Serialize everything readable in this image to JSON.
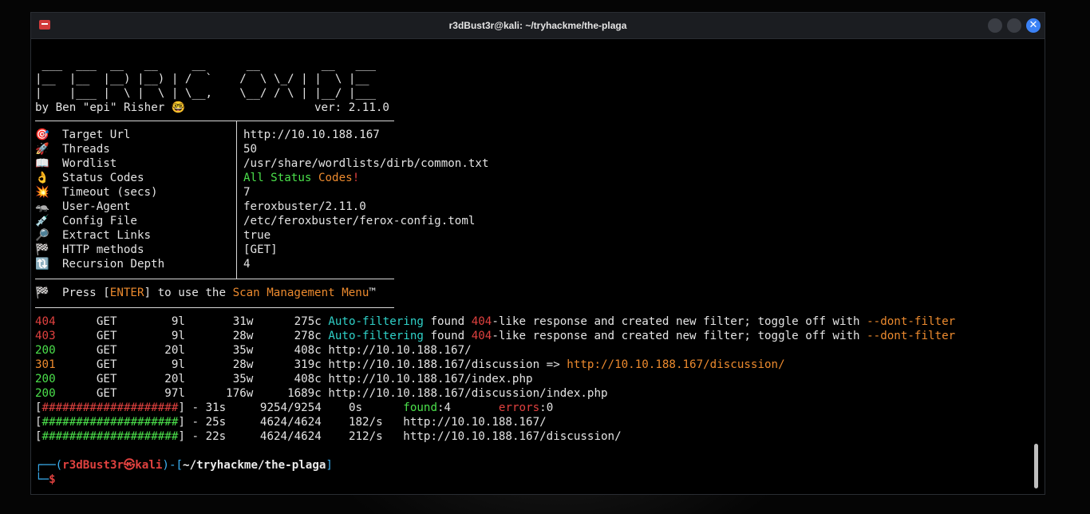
{
  "window": {
    "title": "r3dBust3r@kali: ~/tryhackme/the-plaga",
    "close_glyph": "✕"
  },
  "banner": {
    "line1": " ___  ___  __   __     __      __         __   ___",
    "line2": "|__  |__  |__) |__) | /  `    /  \\ \\_/ | |  \\ |__",
    "line3": "|    |___ |  \\ |  \\ | \\__,    \\__/ / \\ | |__/ |___",
    "author": "by Ben \"epi\" Risher 🤓",
    "version": "ver: 2.11.0"
  },
  "config": [
    {
      "icon": "🎯",
      "key": "Target Url",
      "value": "http://10.10.188.167"
    },
    {
      "icon": "🚀",
      "key": "Threads",
      "value": "50"
    },
    {
      "icon": "📖",
      "key": "Wordlist",
      "value": "/usr/share/wordlists/dirb/common.txt"
    },
    {
      "icon": "👌",
      "key": "Status Codes",
      "value_a": "All Status ",
      "value_b": "Codes",
      "value_c": "!"
    },
    {
      "icon": "💥",
      "key": "Timeout (secs)",
      "value": "7"
    },
    {
      "icon": "🦡",
      "key": "User-Agent",
      "value": "feroxbuster/2.11.0"
    },
    {
      "icon": "💉",
      "key": "Config File",
      "value": "/etc/feroxbuster/ferox-config.toml"
    },
    {
      "icon": "🔎",
      "key": "Extract Links",
      "value": "true"
    },
    {
      "icon": "🏁",
      "key": "HTTP methods",
      "value": "[GET]"
    },
    {
      "icon": "🔃",
      "key": "Recursion Depth",
      "value": "4"
    }
  ],
  "press": {
    "icon": "🏁",
    "a": "Press [",
    "enter": "ENTER",
    "b": "] to use the ",
    "menu": "Scan Management Menu",
    "tm": "™"
  },
  "results": [
    {
      "code": "404",
      "method": "GET",
      "lines": "9l",
      "words": "31w",
      "chars": "275c",
      "msg_a": "Auto-filtering",
      "msg_b": " found ",
      "msg_c": "404",
      "msg_d": "-like response and created new filter; toggle off with ",
      "msg_e": "--dont-filter"
    },
    {
      "code": "403",
      "method": "GET",
      "lines": "9l",
      "words": "28w",
      "chars": "278c",
      "msg_a": "Auto-filtering",
      "msg_b": " found ",
      "msg_c": "404",
      "msg_d": "-like response and created new filter; toggle off with ",
      "msg_e": "--dont-filter"
    },
    {
      "code": "200",
      "method": "GET",
      "lines": "20l",
      "words": "35w",
      "chars": "408c",
      "url": "http://10.10.188.167/"
    },
    {
      "code": "301",
      "method": "GET",
      "lines": "9l",
      "words": "28w",
      "chars": "319c",
      "url": "http://10.10.188.167/discussion => ",
      "redirect": "http://10.10.188.167/discussion/"
    },
    {
      "code": "200",
      "method": "GET",
      "lines": "20l",
      "words": "35w",
      "chars": "408c",
      "url": "http://10.10.188.167/index.php"
    },
    {
      "code": "200",
      "method": "GET",
      "lines": "97l",
      "words": "176w",
      "chars": "1689c",
      "url": "http://10.10.188.167/discussion/index.php"
    }
  ],
  "progress": [
    {
      "bar": "####################",
      "time": "31s",
      "count": "9254/9254",
      "rate": "0s",
      "found_label": "found",
      "found": ":4",
      "errors_label": "errors",
      "errors": ":0"
    },
    {
      "bar": "####################",
      "time": "25s",
      "count": "4624/4624",
      "rate": "182/s",
      "target": "http://10.10.188.167/"
    },
    {
      "bar": "####################",
      "time": "22s",
      "count": "4624/4624",
      "rate": "212/s",
      "target": "http://10.10.188.167/discussion/"
    }
  ],
  "prompt": {
    "corner1": "┌──(",
    "user": "r3dBust3r",
    "skull": "㉿",
    "host": "kali",
    "mid": ")-[",
    "path": "~/tryhackme/the-plaga",
    "end": "]",
    "corner2": "└─",
    "dollar": "$"
  }
}
